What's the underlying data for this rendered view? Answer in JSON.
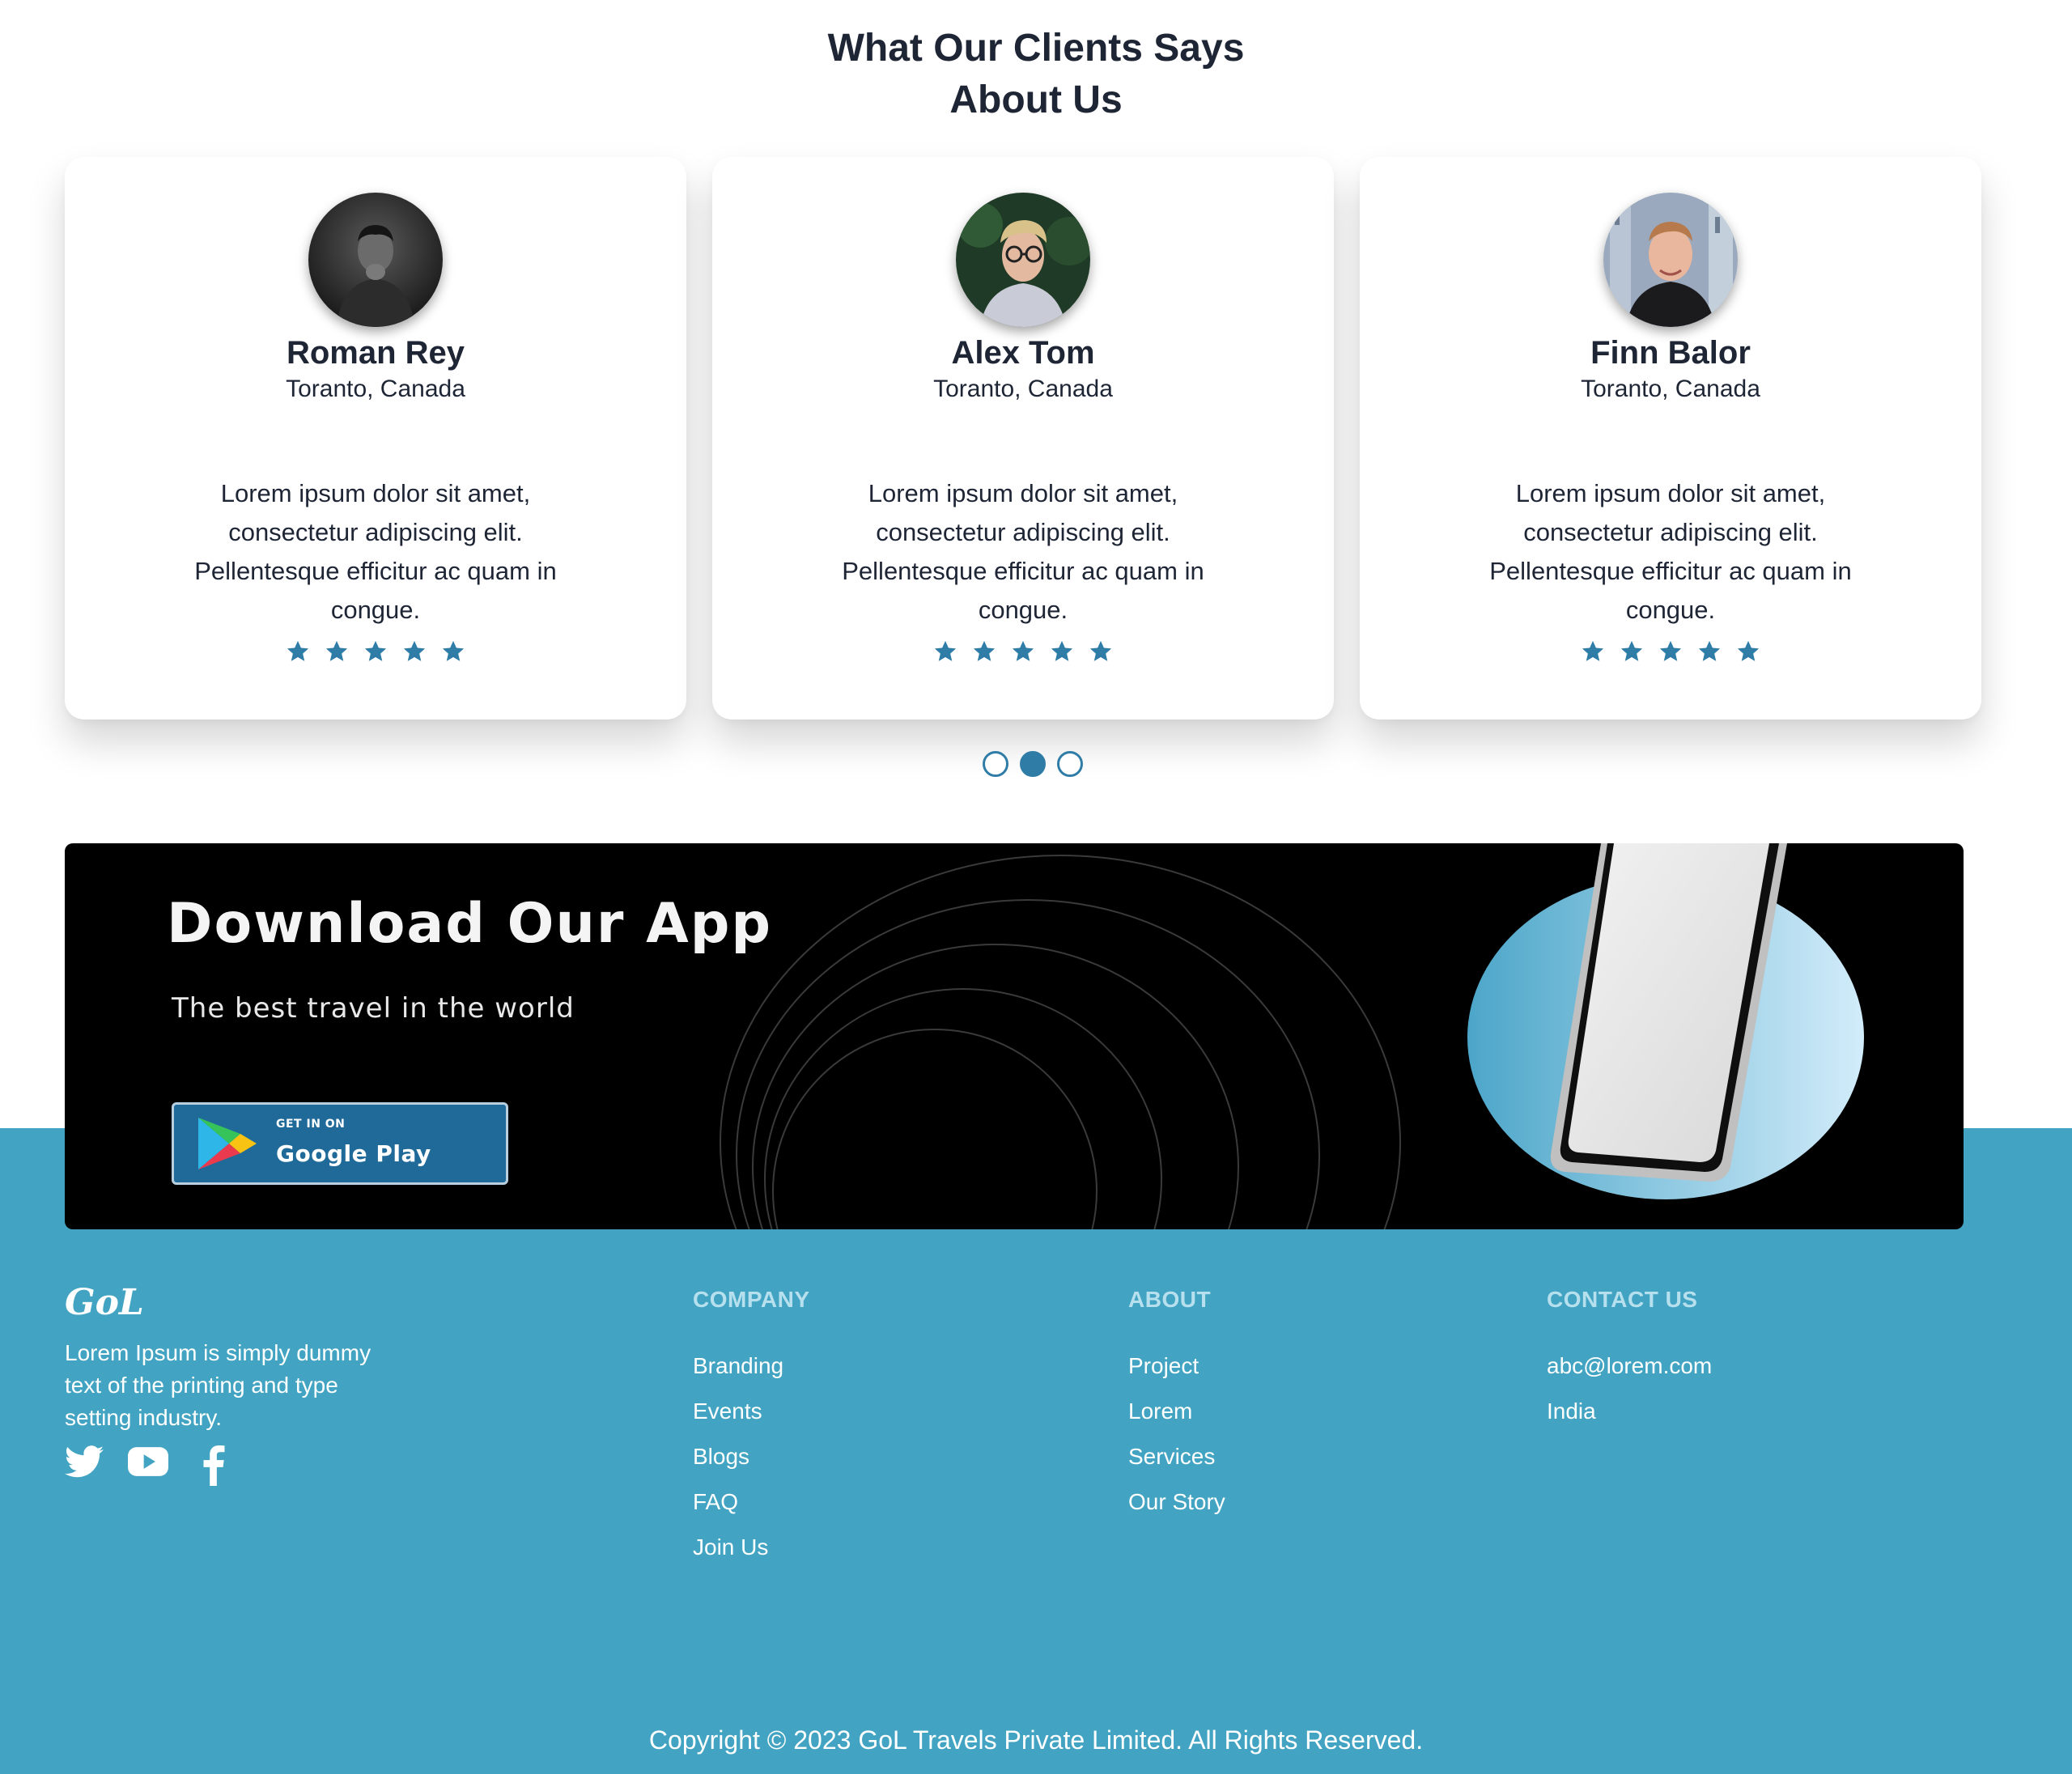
{
  "testimonials": {
    "title_line1": "What Our Clients Says",
    "title_line2": "About Us",
    "cards": [
      {
        "name": "Roman Rey",
        "location": "Toranto, Canada",
        "text": "Lorem ipsum dolor sit amet, consectetur adipiscing elit. Pellentesque efficitur ac quam in congue.",
        "rating": 5
      },
      {
        "name": "Alex Tom",
        "location": "Toranto, Canada",
        "text": "Lorem ipsum dolor sit amet, consectetur adipiscing elit. Pellentesque efficitur ac quam in congue.",
        "rating": 5
      },
      {
        "name": "Finn Balor",
        "location": "Toranto, Canada",
        "text": "Lorem ipsum dolor sit amet, consectetur adipiscing elit. Pellentesque efficitur ac quam in congue.",
        "rating": 5
      }
    ],
    "carousel": {
      "page_count": 3,
      "active_page": 2
    }
  },
  "app_banner": {
    "title": "Download Our App",
    "subtitle": "The best travel in the world",
    "store_button": {
      "small": "GET IN ON",
      "big": "Google Play"
    }
  },
  "footer": {
    "logo": "GoL",
    "about": "Lorem Ipsum is simply dummy text of the printing and type setting industry.",
    "social": [
      "twitter-icon",
      "youtube-icon",
      "facebook-icon"
    ],
    "columns": [
      {
        "heading": "COMPANY",
        "links": [
          "Branding",
          "Events",
          "Blogs",
          "FAQ",
          "Join Us"
        ]
      },
      {
        "heading": "ABOUT",
        "links": [
          "Project",
          "Lorem",
          "Services",
          "Our Story"
        ]
      },
      {
        "heading": "CONTACT US",
        "links": [
          "abc@lorem.com",
          "India"
        ]
      }
    ],
    "copyright": "Copyright © 2023 GoL Travels Private Limited. All Rights Reserved."
  },
  "colors": {
    "accent": "#2f7da6",
    "footer_bg": "#42a4c2",
    "heading": "#1e2535",
    "footer_heading": "#b7e0ee"
  }
}
